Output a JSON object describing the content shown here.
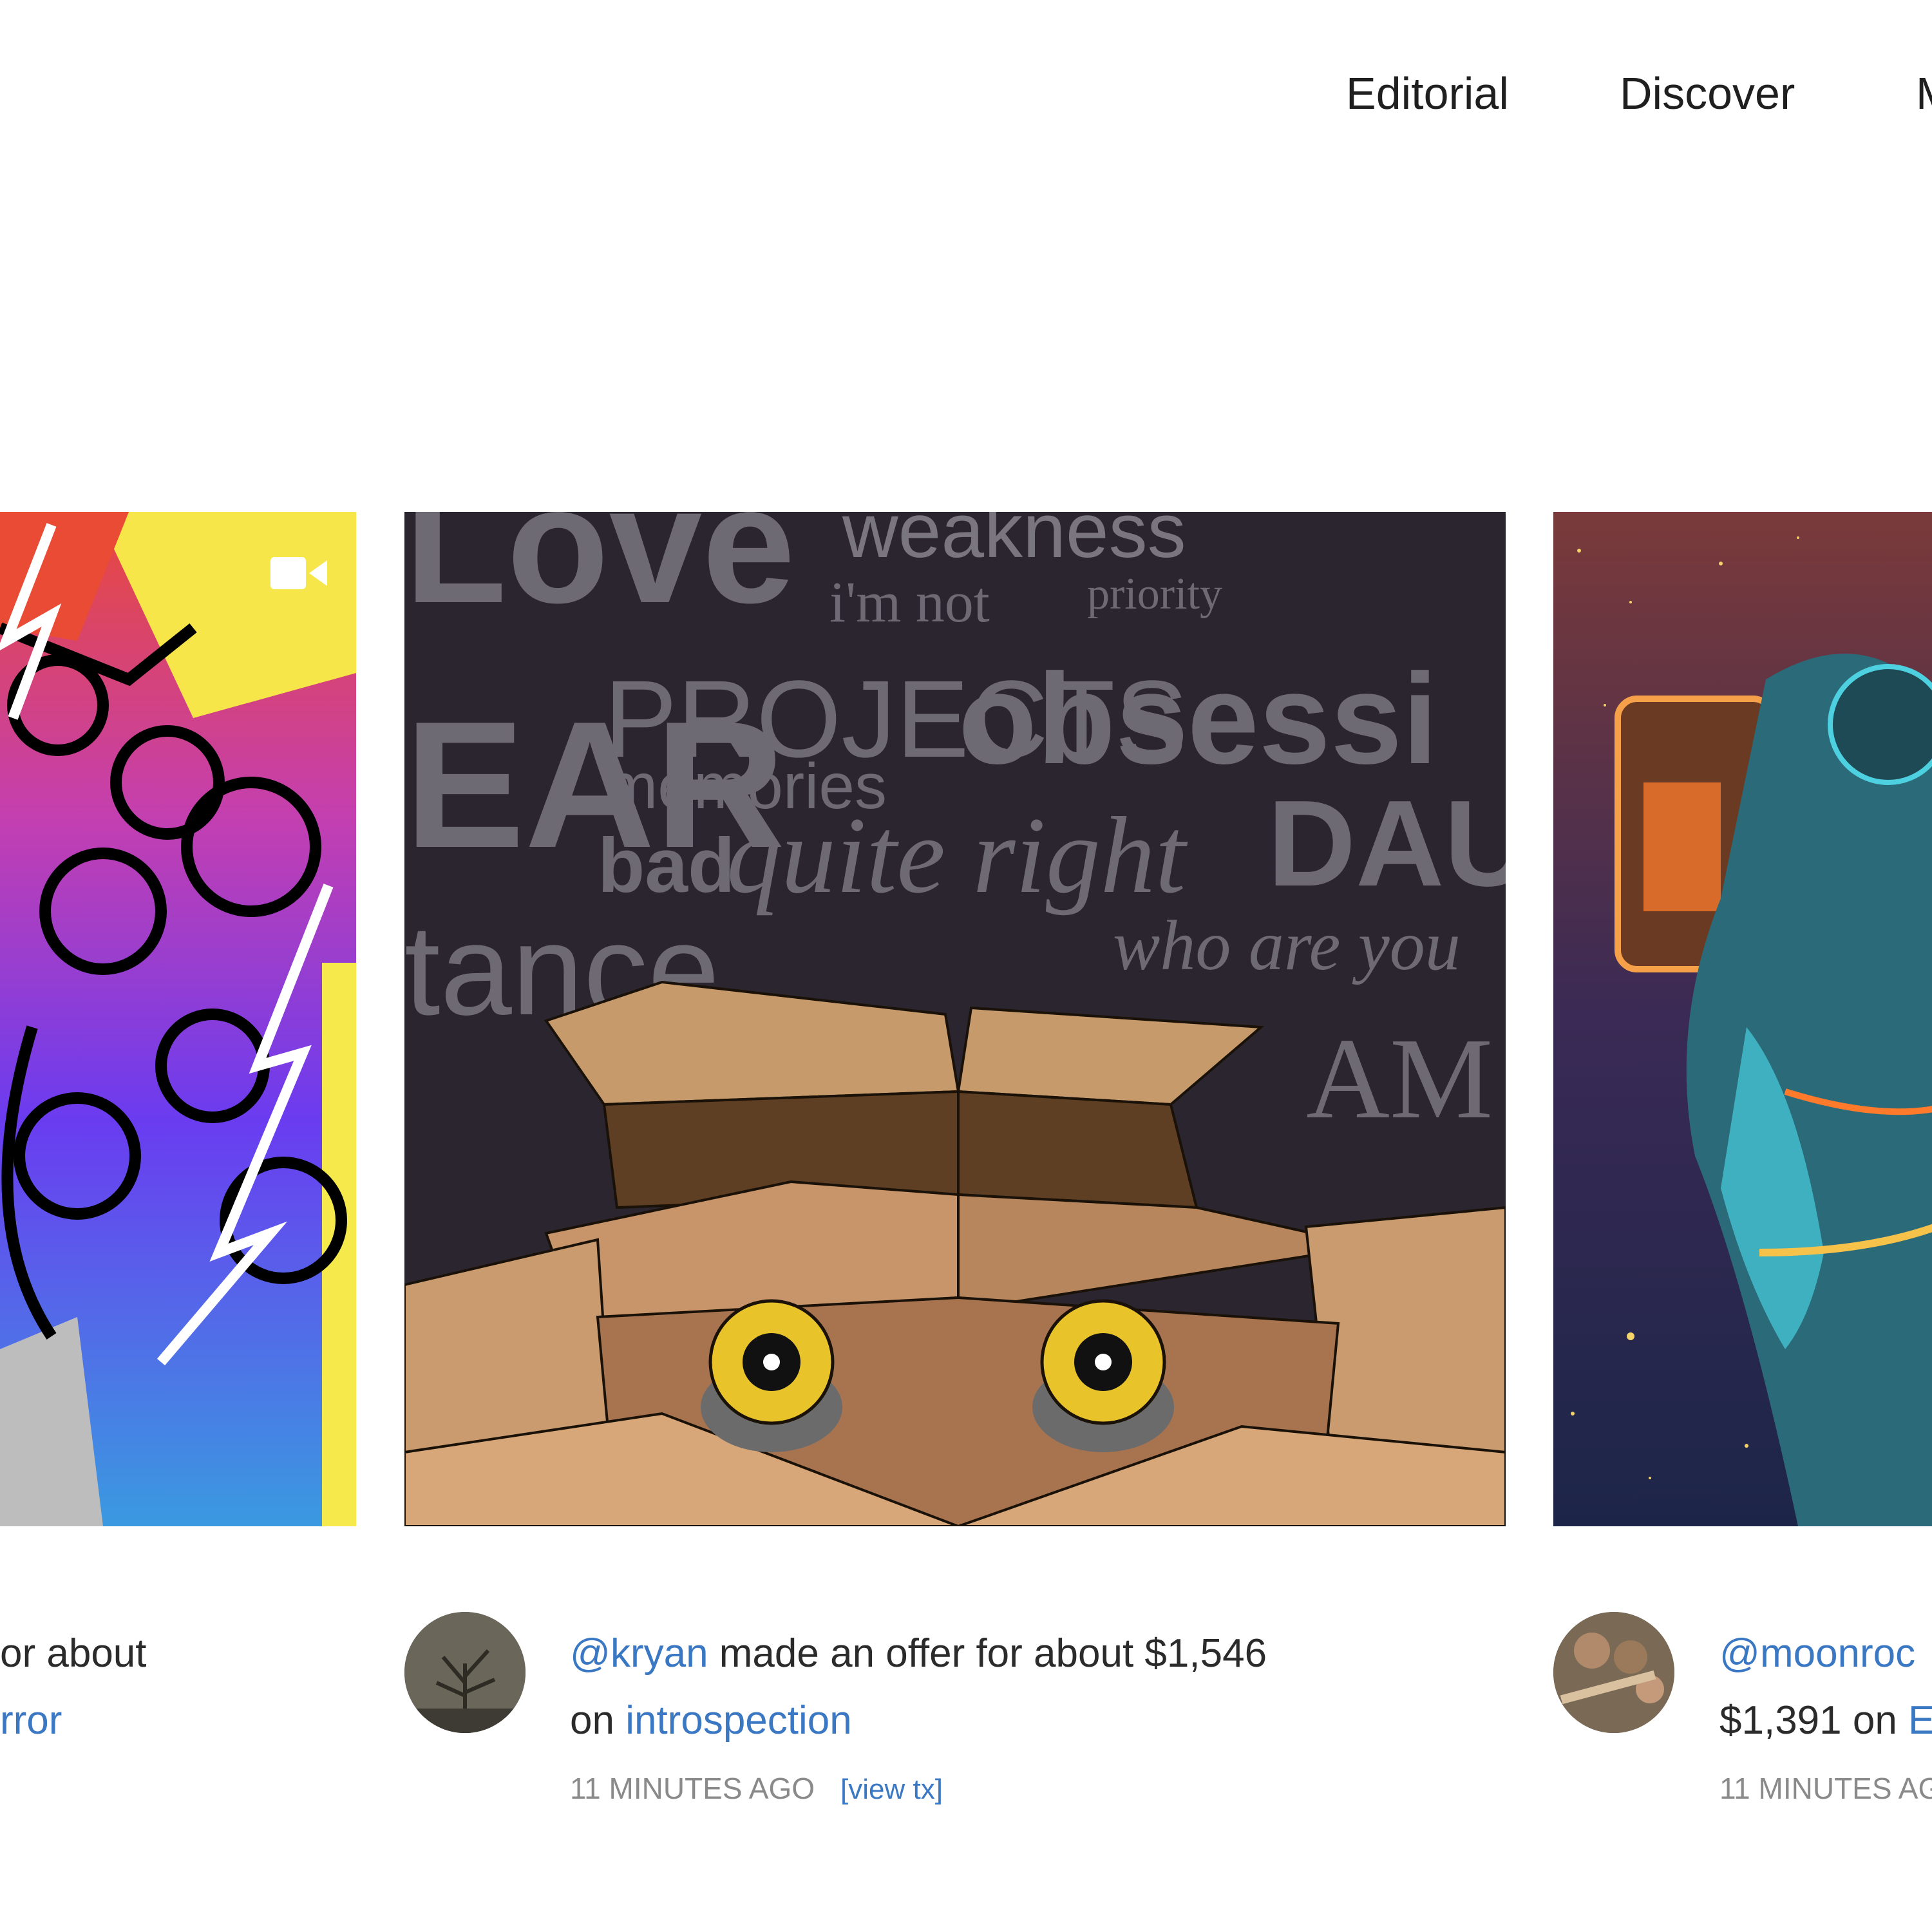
{
  "nav": {
    "items": [
      {
        "label": "Editorial"
      },
      {
        "label": "Discover"
      },
      {
        "label": "M"
      }
    ]
  },
  "cards": [
    {
      "caption_line1_tail": "or about",
      "caption_line2_link": "rror",
      "has_video_icon": true
    },
    {
      "user": "@kryan",
      "action": " made an offer for about $1,546",
      "on": "on ",
      "artwork": "introspection",
      "time": "11 MINUTES AGO",
      "tx_label": "[view tx]"
    },
    {
      "user": "@moonroc",
      "amount": "$1,391 on ",
      "artwork": "E",
      "time": "11 MINUTES AG"
    }
  ],
  "artwork_text": {
    "w1": "weakness",
    "w2": "i'm not",
    "w3": "priority",
    "w4": "PROJECTS",
    "w5": "obsessi",
    "w6": "memories",
    "w7": "bad",
    "w8": "quite right",
    "w9": "DAUG",
    "w10": "who are you",
    "w11": "EAR",
    "w12": "tance"
  },
  "colors": {
    "link": "#3b78c4",
    "text": "#2b2b2b",
    "meta": "#8a8a8a"
  }
}
